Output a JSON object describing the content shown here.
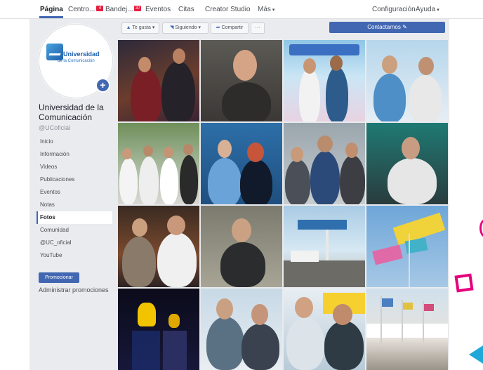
{
  "topnav": {
    "items": [
      {
        "label": "Página"
      },
      {
        "label": "Centro..."
      },
      {
        "label": "Bandej..."
      },
      {
        "label": "Eventos"
      },
      {
        "label": "Citas"
      },
      {
        "label": "Creator Studio"
      },
      {
        "label": "Más"
      },
      {
        "label": "Configuración"
      },
      {
        "label": "Ayuda"
      }
    ],
    "badges": {
      "centro": "4",
      "bandeja": "37"
    }
  },
  "profile": {
    "logo_line1": "Universidad",
    "logo_line2": "de la Comunicación",
    "name": "Universidad de la Comunicación",
    "handle": "@UCoficial"
  },
  "sidebar": {
    "items": [
      {
        "label": "Inicio"
      },
      {
        "label": "Información"
      },
      {
        "label": "Videos"
      },
      {
        "label": "Publicaciones"
      },
      {
        "label": "Eventos"
      },
      {
        "label": "Notas"
      },
      {
        "label": "Fotos",
        "active": true
      },
      {
        "label": "Comunidad"
      },
      {
        "label": "@UC_oficial"
      },
      {
        "label": "YouTube"
      }
    ],
    "promote_label": "Promocionar",
    "manage_promotions": "Administrar promociones"
  },
  "actions": {
    "like": "Te gusta",
    "follow": "Siguiendo",
    "share": "Compartir",
    "more": "···",
    "contact": "Contactarnos"
  },
  "photos": [
    {
      "label": "Two men at night event"
    },
    {
      "label": "Man with mustache"
    },
    {
      "label": "Two men at outdoor expo"
    },
    {
      "label": "Two men with badges"
    },
    {
      "label": "Group of six attendees"
    },
    {
      "label": "Couple with badges"
    },
    {
      "label": "Three men in front of banner"
    },
    {
      "label": "Man speaking at microphone"
    },
    {
      "label": "Two men at night party"
    },
    {
      "label": "Man in dark shirt"
    },
    {
      "label": "Harbor with boats"
    },
    {
      "label": "Colorful festival flags"
    },
    {
      "label": "Golden lion award displays"
    },
    {
      "label": "Two men smiling"
    },
    {
      "label": "Two men near media center"
    },
    {
      "label": "Flags on promenade"
    }
  ]
}
